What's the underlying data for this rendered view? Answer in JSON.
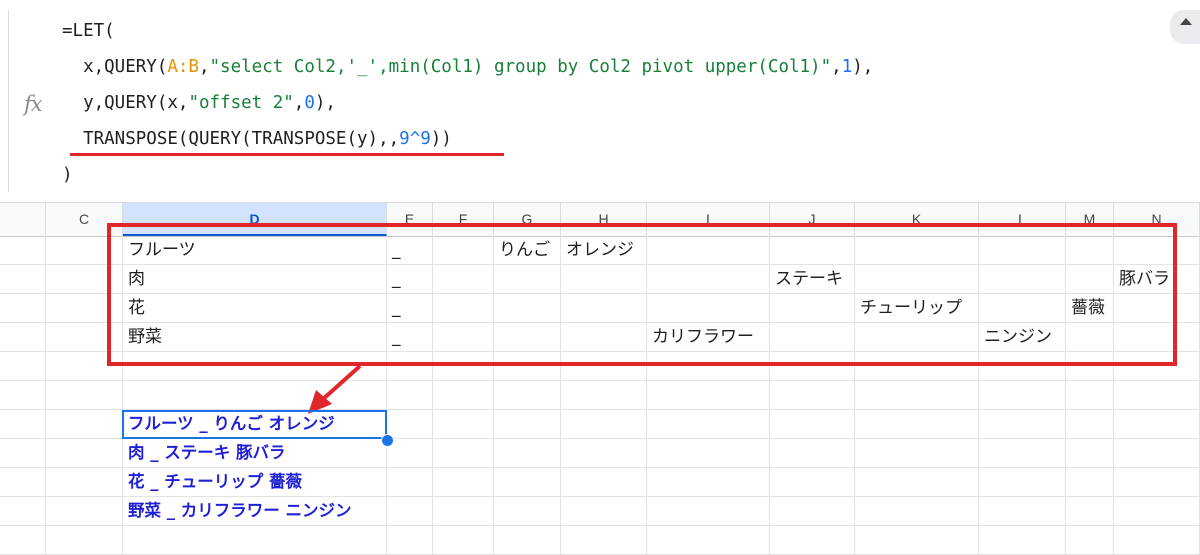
{
  "formula": {
    "icon": "fx-icon",
    "lines": [
      [
        {
          "t": "=LET(",
          "c": "def"
        }
      ],
      [
        {
          "t": "  x,QUERY(",
          "c": "def"
        },
        {
          "t": "A:B",
          "c": "ref"
        },
        {
          "t": ",",
          "c": "def"
        },
        {
          "t": "\"select Col2,'_',min(Col1) group by Col2 pivot upper(Col1)\"",
          "c": "str"
        },
        {
          "t": ",",
          "c": "def"
        },
        {
          "t": "1",
          "c": "num"
        },
        {
          "t": "),",
          "c": "def"
        }
      ],
      [
        {
          "t": "  y,QUERY(x,",
          "c": "def"
        },
        {
          "t": "\"offset 2\"",
          "c": "str"
        },
        {
          "t": ",",
          "c": "def"
        },
        {
          "t": "0",
          "c": "num"
        },
        {
          "t": "),",
          "c": "def"
        }
      ],
      [
        {
          "t": "  TRANSPOSE(QUERY(TRANSPOSE(y),,",
          "c": "def"
        },
        {
          "t": "9^9",
          "c": "num"
        },
        {
          "t": "))",
          "c": "def"
        }
      ],
      [
        {
          "t": ")",
          "c": "def"
        }
      ]
    ]
  },
  "columns": [
    "",
    "C",
    "D",
    "E",
    "F",
    "G",
    "H",
    "I",
    "J",
    "K",
    "L",
    "M",
    "N"
  ],
  "selected_column": "D",
  "pivot_rows": [
    {
      "D": "フルーツ",
      "E": "_",
      "G": "りんご",
      "H": "オレンジ"
    },
    {
      "D": "肉",
      "E": "_",
      "J": "ステーキ",
      "N": "豚バラ"
    },
    {
      "D": "花",
      "E": "_",
      "K": "チューリップ",
      "M": "薔薇"
    },
    {
      "D": "野菜",
      "E": "_",
      "I": "カリフラワー",
      "L": "ニンジン"
    }
  ],
  "result_rows": [
    "フルーツ _  りんご オレンジ",
    "肉 _    ステーキ   豚バラ",
    "花 _     チューリップ  薔薇",
    "野菜 _   カリフラワー   ニンジン"
  ],
  "colors": {
    "accent": "#1a73e8",
    "annotation": "#e0262b",
    "result_text": "#1f1fd6"
  }
}
